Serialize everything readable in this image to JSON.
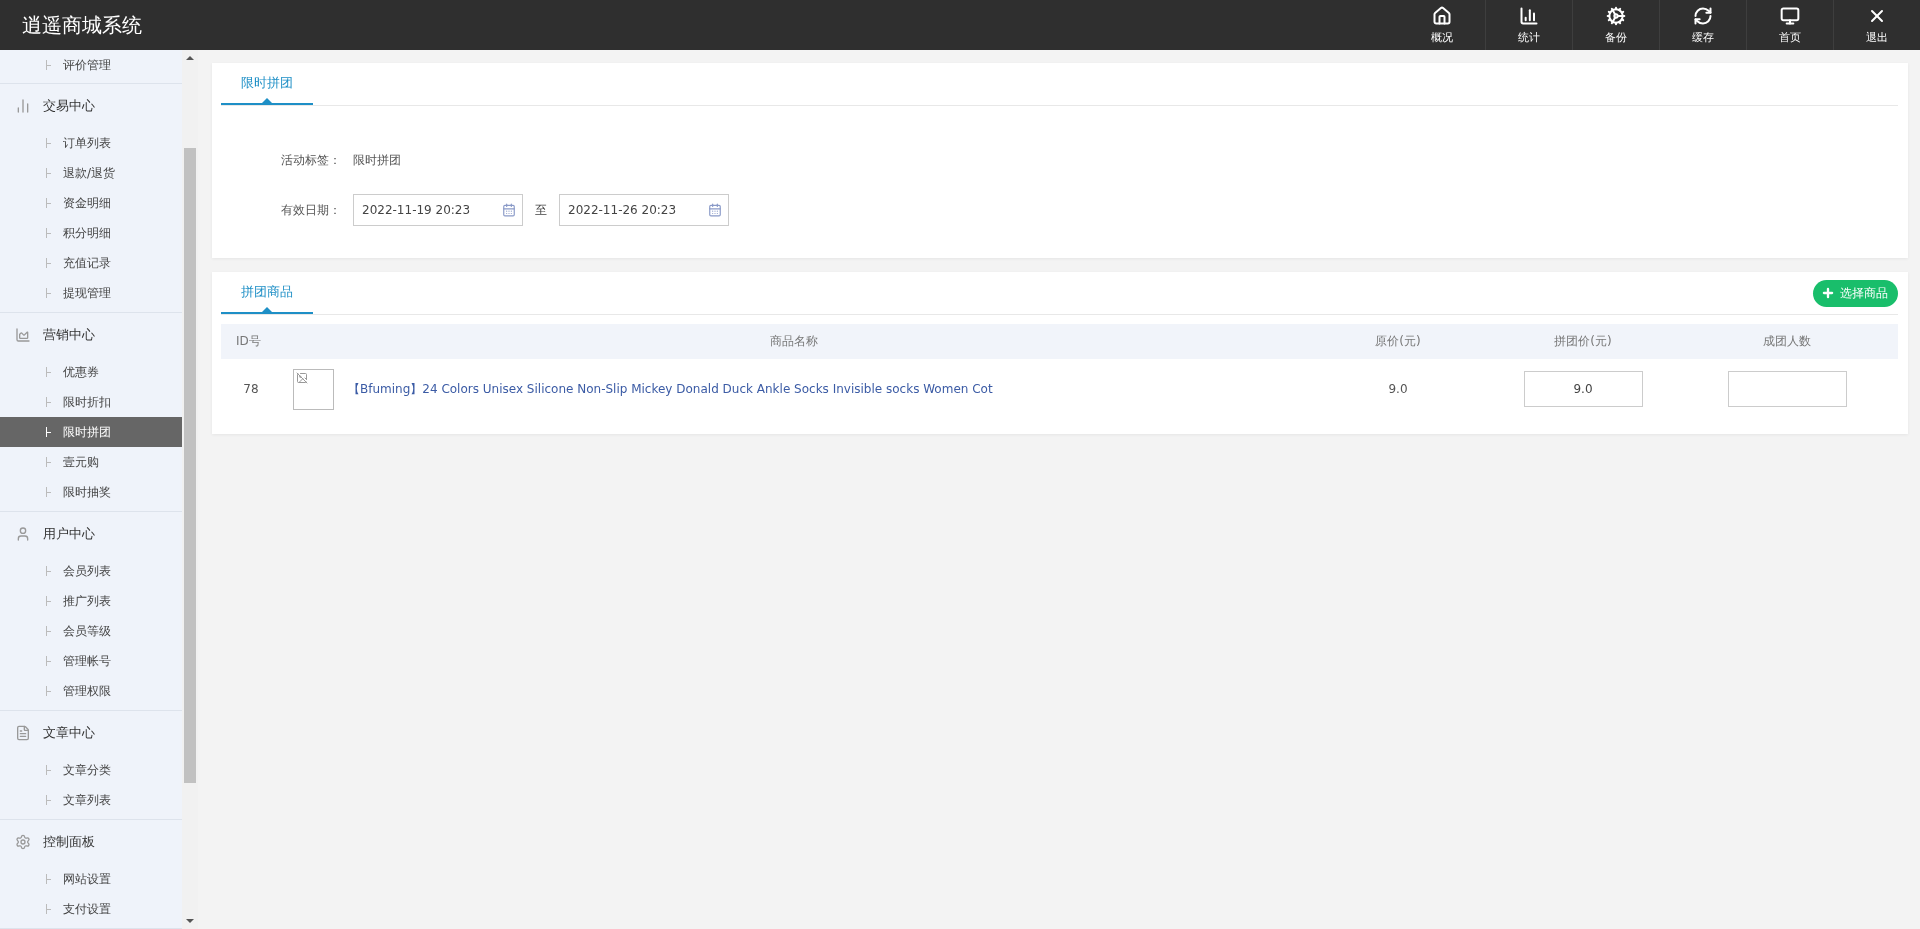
{
  "app_title": "逍遥商城系统",
  "top_nav": [
    {
      "label": "概况"
    },
    {
      "label": "统计"
    },
    {
      "label": "备份"
    },
    {
      "label": "缓存"
    },
    {
      "label": "首页"
    },
    {
      "label": "退出"
    }
  ],
  "sidebar": {
    "groups": [
      {
        "items": [
          {
            "label": "评价管理",
            "selected": false
          }
        ]
      },
      {
        "title": "交易中心",
        "items": [
          {
            "label": "订单列表",
            "selected": false
          },
          {
            "label": "退款/退货",
            "selected": false
          },
          {
            "label": "资金明细",
            "selected": false
          },
          {
            "label": "积分明细",
            "selected": false
          },
          {
            "label": "充值记录",
            "selected": false
          },
          {
            "label": "提现管理",
            "selected": false
          }
        ]
      },
      {
        "title": "营销中心",
        "items": [
          {
            "label": "优惠券",
            "selected": false
          },
          {
            "label": "限时折扣",
            "selected": false
          },
          {
            "label": "限时拼团",
            "selected": true
          },
          {
            "label": "壹元购",
            "selected": false
          },
          {
            "label": "限时抽奖",
            "selected": false
          }
        ]
      },
      {
        "title": "用户中心",
        "items": [
          {
            "label": "会员列表",
            "selected": false
          },
          {
            "label": "推广列表",
            "selected": false
          },
          {
            "label": "会员等级",
            "selected": false
          },
          {
            "label": "管理帐号",
            "selected": false
          },
          {
            "label": "管理权限",
            "selected": false
          }
        ]
      },
      {
        "title": "文章中心",
        "items": [
          {
            "label": "文章分类",
            "selected": false
          },
          {
            "label": "文章列表",
            "selected": false
          }
        ]
      },
      {
        "title": "控制面板",
        "items": [
          {
            "label": "网站设置",
            "selected": false
          },
          {
            "label": "支付设置",
            "selected": false
          }
        ]
      }
    ]
  },
  "activity_panel": {
    "tabs": [
      {
        "label": "限时拼团",
        "selected": true
      }
    ],
    "tag_field": {
      "label": "活动标签：",
      "value": "限时拼团"
    },
    "date_field": {
      "label": "有效日期：",
      "start": "2022-11-19 20:23",
      "separator": "至",
      "end": "2022-11-26 20:23"
    }
  },
  "products_panel": {
    "tabs": [
      {
        "label": "拼团商品",
        "selected": true
      }
    ],
    "add_button": "选择商品",
    "table": {
      "columns": [
        "ID号",
        "商品名称",
        "原价(元)",
        "拼团价(元)",
        "成团人数"
      ],
      "rows": [
        {
          "id": "78",
          "name": "【Bfuming】24 Colors Unisex Silicone Non-Slip Mickey Donald Duck Ankle Socks Invisible socks Women Cot",
          "original_price": "9.0",
          "group_price": "9.0"
        }
      ]
    }
  }
}
